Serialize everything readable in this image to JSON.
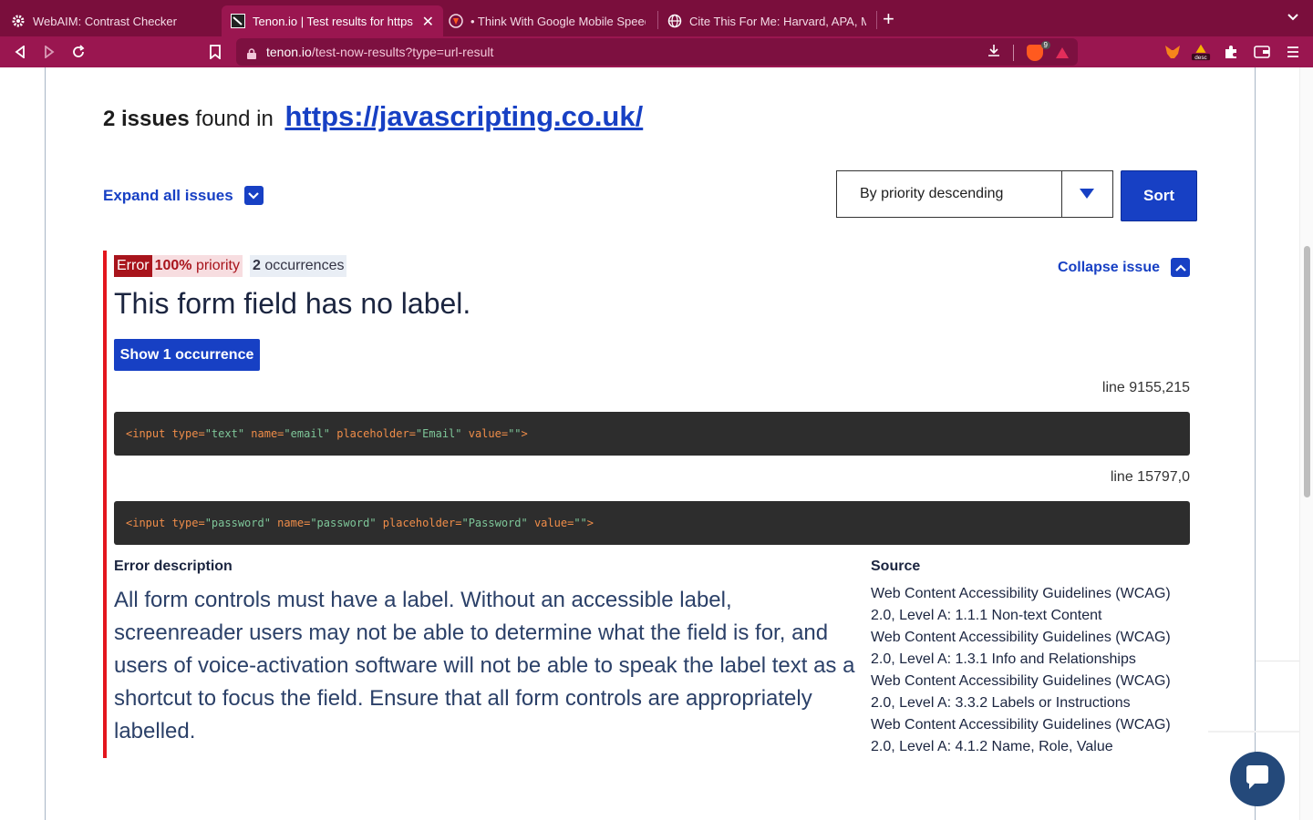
{
  "browser": {
    "tabs": [
      {
        "title": "WebAIM: Contrast Checker",
        "icon": "gear-icon",
        "active": false
      },
      {
        "title": "Tenon.io | Test results for https",
        "icon": "tenon-icon",
        "active": true
      },
      {
        "title": "• Think With Google Mobile Speed",
        "icon": "brave-icon",
        "active": false
      },
      {
        "title": "Cite This For Me: Harvard, APA, ML",
        "icon": "globe-icon",
        "active": false
      }
    ],
    "url_host": "tenon.io",
    "url_path": "/test-now-results?type=url-result",
    "shields_count": "9",
    "ext_label": "desc"
  },
  "summary": {
    "count": "2 issues",
    "found_in": "found in",
    "site_url": "https://javascripting.co.uk/"
  },
  "controls": {
    "expand_all": "Expand all issues",
    "sort_value": "By priority descending",
    "sort_button": "Sort"
  },
  "issue": {
    "badge_error": "Error",
    "priority_value": "100%",
    "priority_label": "priority",
    "occurrences_count": "2",
    "occurrences_label": "occurrences",
    "collapse": "Collapse issue",
    "title": "This form field has no label.",
    "show_button": "Show 1 occurrence",
    "occurrences": [
      {
        "line": "line 9155,215",
        "code_parts": [
          "<input type=",
          "\"text\"",
          " name=",
          "\"email\"",
          " placeholder=",
          "\"Email\"",
          " value=",
          "\"\"",
          ">"
        ]
      },
      {
        "line": "line 15797,0",
        "code_parts": [
          "<input type=",
          "\"password\"",
          " name=",
          "\"password\"",
          " placeholder=",
          "\"Password\"",
          " value=",
          "\"\"",
          ">"
        ]
      }
    ],
    "description_heading": "Error description",
    "description": "All form controls must have a label. Without an accessible label, screenreader users may not be able to determine what the field is for, and users of voice-activation software will not be able to speak the label text as a shortcut to focus the field. Ensure that all form controls are appropriately labelled.",
    "source_heading": "Source",
    "sources": [
      "Web Content Accessibility Guidelines (WCAG) 2.0, Level A: 1.1.1 Non-text Content",
      "Web Content Accessibility Guidelines (WCAG) 2.0, Level A: 1.3.1 Info and Relationships",
      "Web Content Accessibility Guidelines (WCAG) 2.0, Level A: 3.3.2 Labels or Instructions",
      "Web Content Accessibility Guidelines (WCAG) 2.0, Level A: 4.1.2 Name, Role, Value"
    ]
  },
  "colors": {
    "accent": "#1740c4",
    "error": "#e3161e",
    "chrome": "#9a1650"
  }
}
